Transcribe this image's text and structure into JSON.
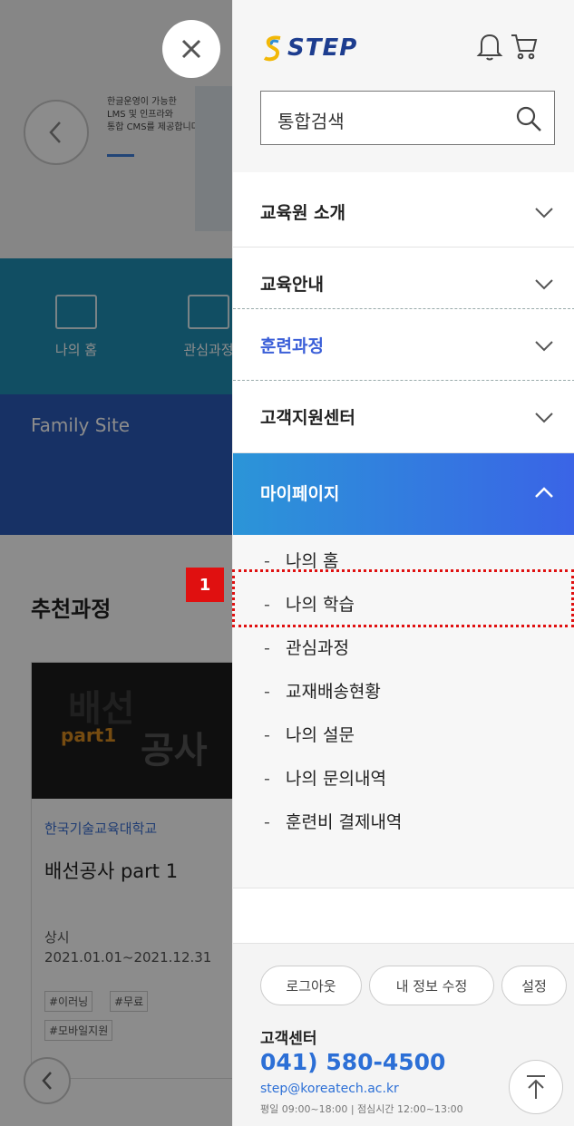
{
  "background": {
    "banner_text": "한글운영이 가능한\nLMS 및 인프라와\n통합 CMS를 제공합니다",
    "quick_links": [
      "나의 홈",
      "관심과정"
    ],
    "family_site": "Family Site",
    "section_title": "추천과정",
    "course": {
      "thumb_line1": "배선",
      "thumb_line2": "part1",
      "thumb_line3": "공사",
      "univ": "한국기술교육대학교",
      "name": "배선공사 part 1",
      "schedule_label": "상시",
      "schedule": "2021.01.01~2021.12.31",
      "tags": [
        "#이러닝",
        "#무료",
        "#모바일지원"
      ]
    }
  },
  "drawer": {
    "logo_text": "STEP",
    "search_placeholder": "통합검색",
    "menu": [
      {
        "label": "교육원 소개"
      },
      {
        "label": "교육안내"
      },
      {
        "label": "훈련과정"
      },
      {
        "label": "고객지원센터"
      },
      {
        "label": "마이페이지"
      }
    ],
    "submenu": [
      "나의 홈",
      "나의 학습",
      "관심과정",
      "교재배송현황",
      "나의 설문",
      "나의 문의내역",
      "훈련비 결제내역"
    ],
    "marker": "1",
    "footer": {
      "logout": "로그아웃",
      "edit_info": "내 정보 수정",
      "settings": "설정",
      "cs_title": "고객센터",
      "cs_phone": "041) 580-4500",
      "cs_email": "step@koreatech.ac.kr",
      "cs_hours": "평일 09:00~18:00 | 점심시간 12:00~13:00"
    }
  },
  "colors": {
    "accent_blue": "#2c6fd6",
    "active_gradient_start": "#2b95d8",
    "active_gradient_end": "#3a64e6",
    "training_course_text": "#3b5fd8",
    "annotation_red": "#e01010"
  }
}
